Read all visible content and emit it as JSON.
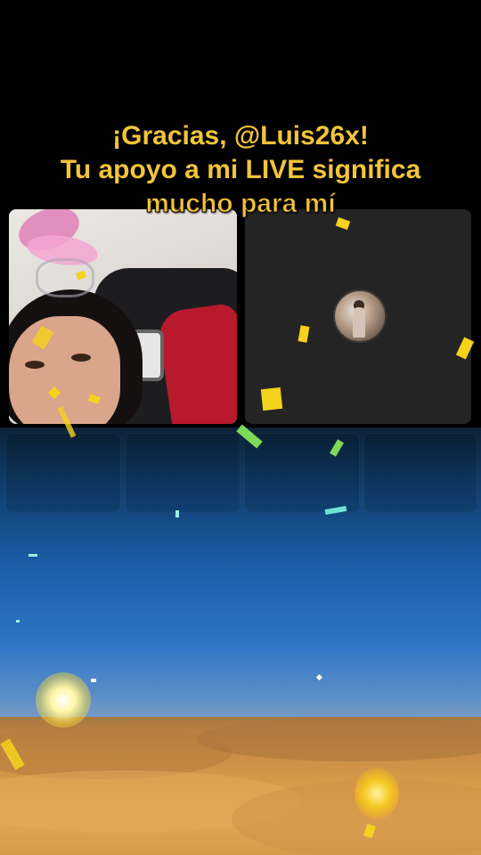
{
  "gift_message": {
    "line1": "¡Gracias, @Luis26x!",
    "line2": "Tu apoyo a mi LIVE significa",
    "line3": "mucho para mí"
  },
  "colors": {
    "message_text": "#f2c43a",
    "confetti_yellow": "#f5d21c",
    "confetti_green": "#7ed957",
    "background": "#000000"
  },
  "participants": [
    {
      "role": "host-video",
      "icon": "camera-feed"
    },
    {
      "role": "guest-avatar",
      "icon": "profile-avatar"
    }
  ]
}
